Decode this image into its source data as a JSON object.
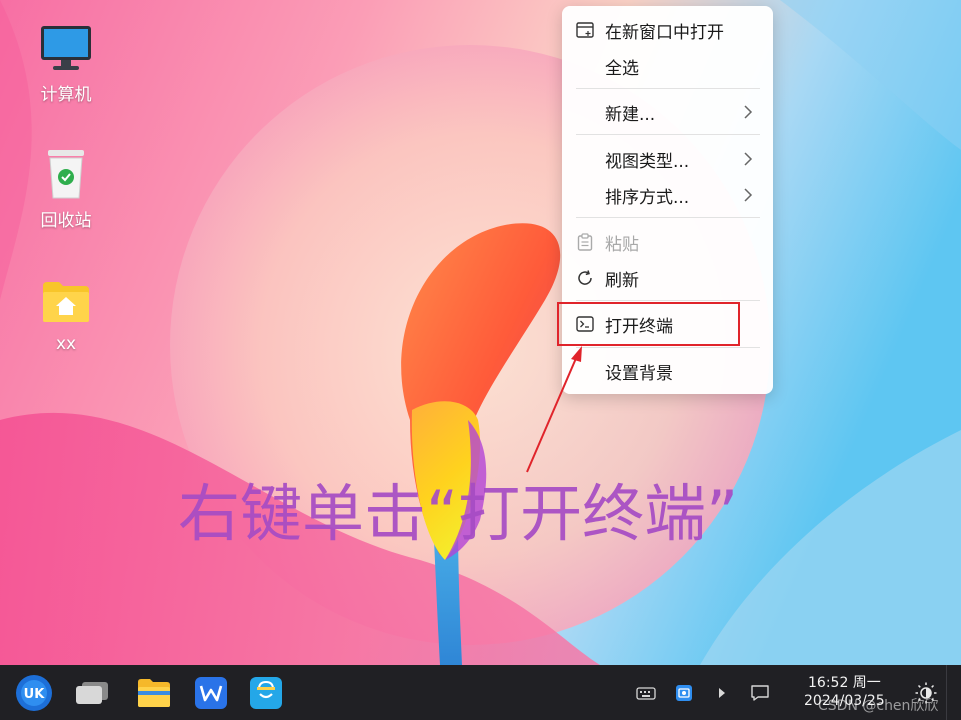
{
  "desktop": {
    "icons": [
      {
        "label": "计算机",
        "icon": "computer-icon"
      },
      {
        "label": "回收站",
        "icon": "recycle-bin-icon"
      },
      {
        "label": "xx",
        "icon": "home-folder-icon"
      }
    ]
  },
  "context_menu": {
    "items": [
      {
        "label": "在新窗口中打开",
        "icon": "new-window-icon",
        "enabled": true,
        "submenu": false
      },
      {
        "label": "全选",
        "icon": "",
        "enabled": true,
        "submenu": false
      },
      {
        "label": "新建...",
        "icon": "",
        "enabled": true,
        "submenu": true
      },
      {
        "label": "视图类型...",
        "icon": "",
        "enabled": true,
        "submenu": true
      },
      {
        "label": "排序方式...",
        "icon": "",
        "enabled": true,
        "submenu": true
      },
      {
        "label": "粘贴",
        "icon": "clipboard-icon",
        "enabled": false,
        "submenu": false
      },
      {
        "label": "刷新",
        "icon": "refresh-icon",
        "enabled": true,
        "submenu": false
      },
      {
        "label": "打开终端",
        "icon": "terminal-icon",
        "enabled": true,
        "submenu": false,
        "highlighted": true
      },
      {
        "label": "设置背景",
        "icon": "",
        "enabled": true,
        "submenu": false
      }
    ]
  },
  "annotation": {
    "caption": "右键单击“打开终端”",
    "color": "#e0242b"
  },
  "taskbar": {
    "apps": [
      {
        "name": "start-menu",
        "icon": "uk-start-icon"
      },
      {
        "name": "multitask-view",
        "icon": "multitask-icon"
      },
      {
        "name": "file-manager",
        "icon": "folder-icon"
      },
      {
        "name": "wps-office",
        "icon": "wps-icon"
      },
      {
        "name": "software-store",
        "icon": "shopping-bag-icon"
      }
    ],
    "tray": [
      {
        "name": "keyboard",
        "icon": "keyboard-icon"
      },
      {
        "name": "screenshot",
        "icon": "screenshot-icon"
      },
      {
        "name": "expand",
        "icon": "chevron-right-icon"
      },
      {
        "name": "notifications",
        "icon": "message-icon"
      },
      {
        "name": "night-mode",
        "icon": "brightness-icon"
      }
    ],
    "clock": {
      "time": "16:52 周一",
      "date": "2024/03/25"
    },
    "watermark": "CSDN @chen欣欣"
  },
  "colors": {
    "taskbar_bg": "#202024",
    "caption": "#a64cc4",
    "highlight": "#e0242b"
  }
}
